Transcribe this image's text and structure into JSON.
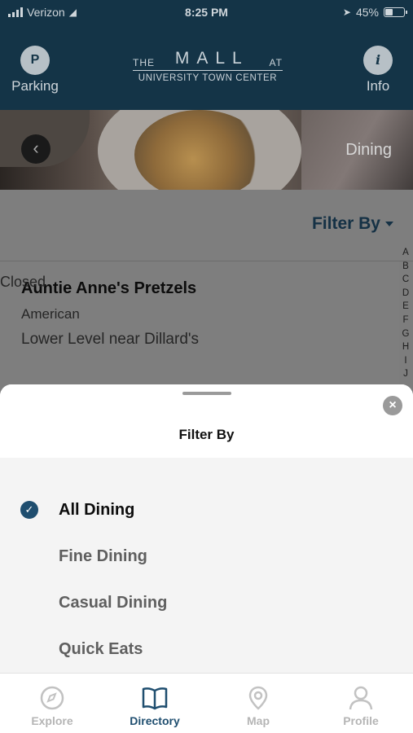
{
  "status_bar": {
    "carrier": "Verizon",
    "time": "8:25 PM",
    "battery": "45%",
    "battery_level": 0.45
  },
  "header": {
    "parking": {
      "icon_letter": "P",
      "label": "Parking"
    },
    "info": {
      "icon_letter": "i",
      "label": "Info"
    },
    "logo": {
      "the": "THE",
      "mall": "MALL",
      "at": "AT",
      "sub": "UNIVERSITY TOWN CENTER"
    },
    "color": "#143447"
  },
  "hero": {
    "label": "Dining"
  },
  "filter": {
    "label": "Filter By"
  },
  "listing": {
    "name": "Auntie Anne's Pretzels",
    "category": "American",
    "location": "Lower Level near Dillard's",
    "status": "Closed"
  },
  "alphabet": [
    "A",
    "B",
    "C",
    "D",
    "E",
    "F",
    "G",
    "H",
    "I",
    "J"
  ],
  "sheet": {
    "title": "Filter By",
    "options": [
      {
        "label": "All Dining",
        "selected": true
      },
      {
        "label": "Fine Dining",
        "selected": false
      },
      {
        "label": "Casual Dining",
        "selected": false
      },
      {
        "label": "Quick Eats",
        "selected": false
      }
    ]
  },
  "tabs": [
    {
      "label": "Explore",
      "icon": "compass-icon",
      "active": false
    },
    {
      "label": "Directory",
      "icon": "book-icon",
      "active": true
    },
    {
      "label": "Map",
      "icon": "map-pin-icon",
      "active": false
    },
    {
      "label": "Profile",
      "icon": "person-icon",
      "active": false
    }
  ],
  "accent_color": "#1f4e6f"
}
